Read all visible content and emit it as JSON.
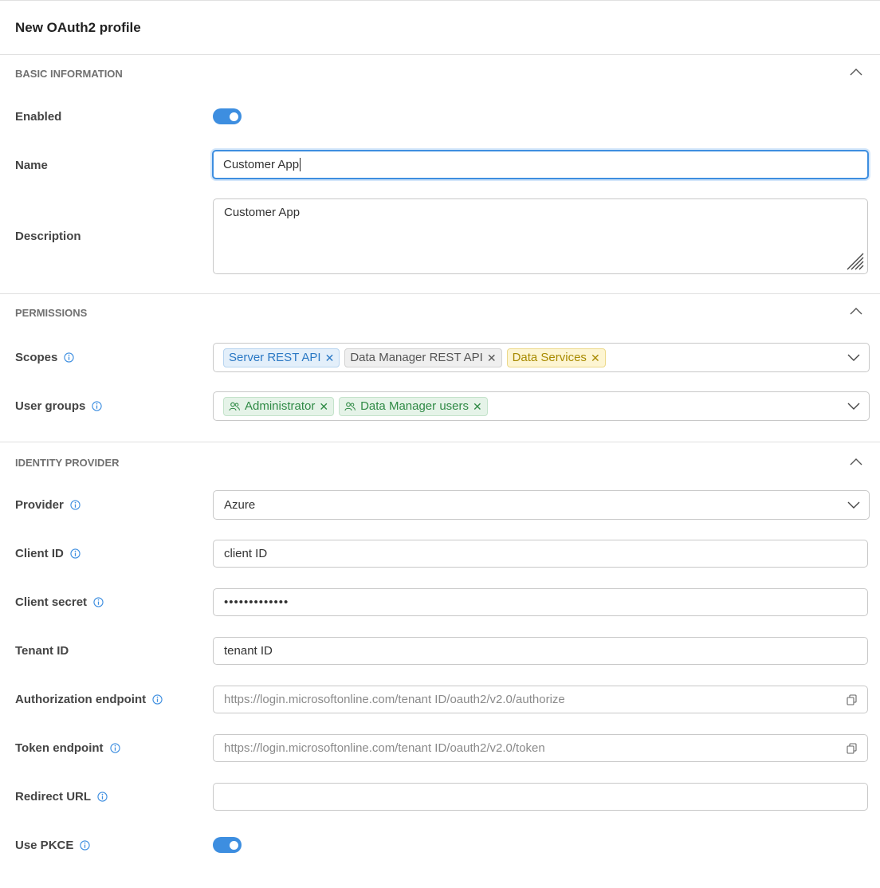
{
  "title": "New OAuth2 profile",
  "sections": {
    "basic": {
      "title": "BASIC INFORMATION",
      "enabled_label": "Enabled",
      "enabled_value": true,
      "name_label": "Name",
      "name_value": "Customer App",
      "description_label": "Description",
      "description_value": "Customer App"
    },
    "permissions": {
      "title": "PERMISSIONS",
      "scopes_label": "Scopes",
      "scopes": [
        {
          "label": "Server REST API",
          "color": "#2a78c4"
        },
        {
          "label": "Data Manager REST API",
          "color": "#555555"
        },
        {
          "label": "Data Services",
          "color": "#a88a00"
        }
      ],
      "user_groups_label": "User groups",
      "user_groups": [
        {
          "label": "Administrator",
          "color": "#2f8a45"
        },
        {
          "label": "Data Manager users",
          "color": "#2f8a45"
        }
      ]
    },
    "identity": {
      "title": "IDENTITY PROVIDER",
      "provider_label": "Provider",
      "provider_value": "Azure",
      "client_id_label": "Client ID",
      "client_id_value": "client ID",
      "client_secret_label": "Client secret",
      "client_secret_value": "•••••••••••••",
      "tenant_id_label": "Tenant ID",
      "tenant_id_value": "tenant ID",
      "auth_endpoint_label": "Authorization endpoint",
      "auth_endpoint_value": "https://login.microsoftonline.com/tenant ID/oauth2/v2.0/authorize",
      "token_endpoint_label": "Token endpoint",
      "token_endpoint_value": "https://login.microsoftonline.com/tenant ID/oauth2/v2.0/token",
      "redirect_url_label": "Redirect URL",
      "redirect_url_value": "",
      "use_pkce_label": "Use PKCE",
      "use_pkce_value": true
    }
  },
  "colors": {
    "accent": "#3d8ee0",
    "info_icon": "#3d8ee0"
  },
  "icons": {
    "collapse": "chevron-up-icon",
    "info": "info-icon",
    "dropdown": "chevron-down-icon",
    "copy": "copy-icon",
    "tag_remove": "close-icon",
    "user_group": "users-icon"
  }
}
